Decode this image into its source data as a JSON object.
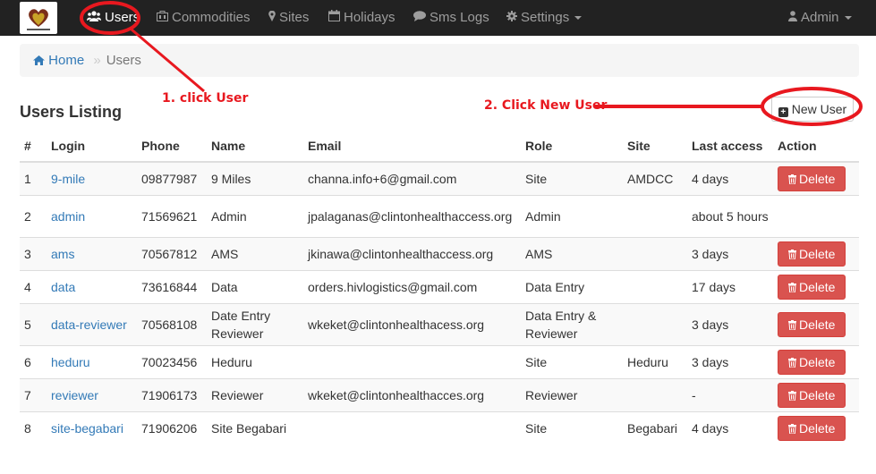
{
  "navbar": {
    "items": [
      {
        "label": "Users",
        "icon": "users-icon",
        "active": true
      },
      {
        "label": "Commodities",
        "icon": "commodities-icon"
      },
      {
        "label": "Sites",
        "icon": "map-marker-icon"
      },
      {
        "label": "Holidays",
        "icon": "calendar-icon"
      },
      {
        "label": "Sms Logs",
        "icon": "comment-icon"
      },
      {
        "label": "Settings",
        "icon": "gear-icon"
      }
    ],
    "user_menu": "Admin"
  },
  "breadcrumb": {
    "home": "Home",
    "separator": "»",
    "current": "Users"
  },
  "page": {
    "title": "Users Listing",
    "new_user_label": "New User"
  },
  "annotations": {
    "step1": "1. click User",
    "step2": "2. Click New User"
  },
  "table": {
    "headers": [
      "#",
      "Login",
      "Phone",
      "Name",
      "Email",
      "Role",
      "Site",
      "Last access",
      "Action"
    ],
    "delete_label": "Delete",
    "rows": [
      {
        "num": "1",
        "login": "9-mile",
        "phone": "09877987",
        "name": "9 Miles",
        "email": "channa.info+6@gmail.com",
        "role": "Site",
        "site": "AMDCC",
        "last": "4 days",
        "action": true
      },
      {
        "num": "2",
        "login": "admin",
        "phone": "71569621",
        "name": "Admin",
        "email": "jpalaganas@clintonhealthaccess.org",
        "role": "Admin",
        "site": "",
        "last": "about 5 hours",
        "action": false
      },
      {
        "num": "3",
        "login": "ams",
        "phone": "70567812",
        "name": "AMS",
        "email": "jkinawa@clintonhealthaccess.org",
        "role": "AMS",
        "site": "",
        "last": "3 days",
        "action": true
      },
      {
        "num": "4",
        "login": "data",
        "phone": "73616844",
        "name": "Data",
        "email": "orders.hivlogistics@gmail.com",
        "role": "Data Entry",
        "site": "",
        "last": "17 days",
        "action": true
      },
      {
        "num": "5",
        "login": "data-reviewer",
        "phone": "70568108",
        "name": "Date Entry Reviewer",
        "email": "wkeket@clintonhealthacess.org",
        "role": "Data Entry & Reviewer",
        "site": "",
        "last": "3 days",
        "action": true
      },
      {
        "num": "6",
        "login": "heduru",
        "phone": "70023456",
        "name": "Heduru",
        "email": "",
        "role": "Site",
        "site": "Heduru",
        "last": "3 days",
        "action": true
      },
      {
        "num": "7",
        "login": "reviewer",
        "phone": "71906173",
        "name": "Reviewer",
        "email": "wkeket@clintonhealthacces.org",
        "role": "Reviewer",
        "site": "",
        "last": "-",
        "action": true
      },
      {
        "num": "8",
        "login": "site-begabari",
        "phone": "71906206",
        "name": "Site Begabari",
        "email": "",
        "role": "Site",
        "site": "Begabari",
        "last": "4 days",
        "action": true
      }
    ]
  },
  "colors": {
    "navbar": "#222222",
    "link": "#337ab7",
    "danger": "#d9534f",
    "annotation": "#e8181f"
  }
}
